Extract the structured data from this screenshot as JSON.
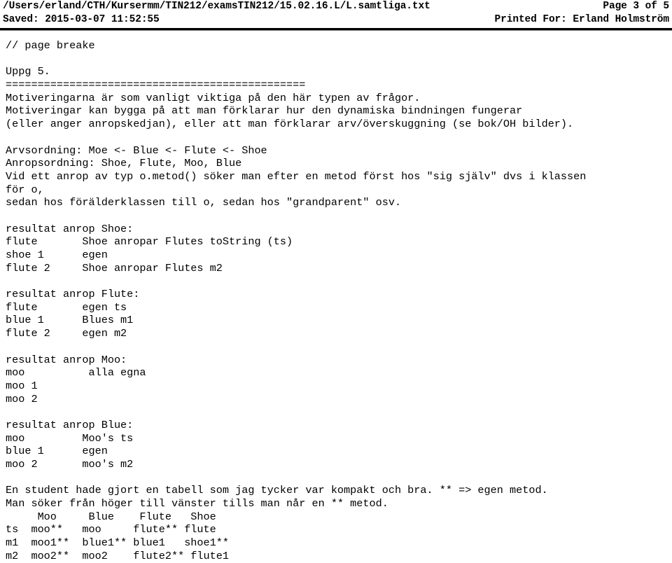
{
  "header": {
    "file_path": "/Users/erland/CTH/Kursermm/TIN212/examsTIN212/15.02.16.L/L.samtliga.txt",
    "page_label": "Page 3 of 5",
    "saved_label": "Saved: 2015-03-07 11:52:55",
    "printed_for_label": "Printed For: Erland Holmström"
  },
  "document": {
    "lines": [
      "// page breake",
      "",
      "Uppg 5.",
      "===============================================",
      "Motiveringarna är som vanligt viktiga på den här typen av frågor.",
      "Motiveringar kan bygga på att man förklarar hur den dynamiska bindningen fungerar",
      "(eller anger anropskedjan), eller att man förklarar arv/överskuggning (se bok/OH bilder).",
      "",
      "Arvsordning: Moe <- Blue <- Flute <- Shoe",
      "Anropsordning: Shoe, Flute, Moo, Blue",
      "Vid ett anrop av typ o.metod() söker man efter en metod först hos \"sig själv\" dvs i klassen",
      "för o,",
      "sedan hos förälderklassen till o, sedan hos \"grandparent\" osv.",
      "",
      "resultat anrop Shoe:",
      "flute       Shoe anropar Flutes toString (ts)",
      "shoe 1      egen",
      "flute 2     Shoe anropar Flutes m2",
      "",
      "resultat anrop Flute:",
      "flute       egen ts",
      "blue 1      Blues m1",
      "flute 2     egen m2",
      "",
      "resultat anrop Moo:",
      "moo          alla egna",
      "moo 1",
      "moo 2",
      "",
      "resultat anrop Blue:",
      "moo         Moo's ts",
      "blue 1      egen",
      "moo 2       moo's m2",
      "",
      "En student hade gjort en tabell som jag tycker var kompakt och bra. ** => egen metod.",
      "Man söker från höger till vänster tills man når en ** metod.",
      "     Moo     Blue    Flute   Shoe",
      "ts  moo**   moo     flute** flute",
      "m1  moo1**  blue1** blue1   shoe1**",
      "m2  moo2**  moo2    flute2** flute1"
    ]
  }
}
